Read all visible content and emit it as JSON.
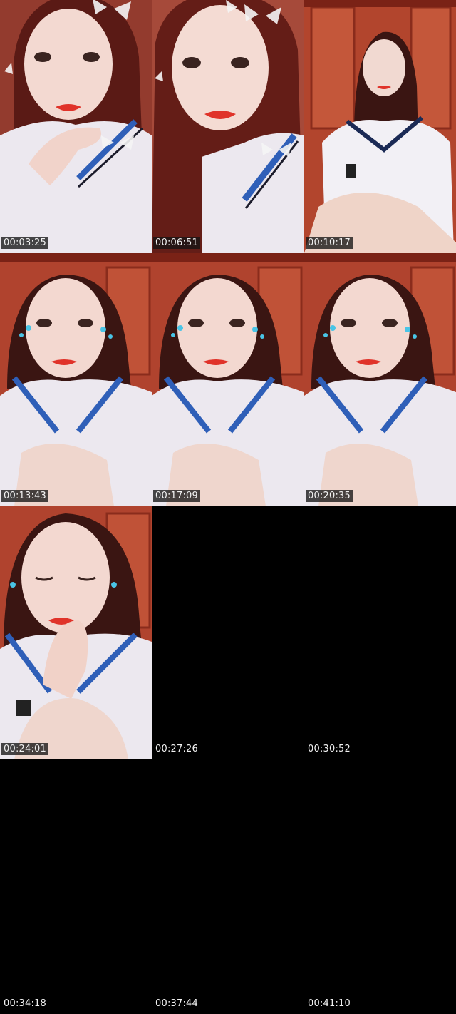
{
  "frames": [
    {
      "timestamp": "00:03:25",
      "has_image": true,
      "scene": "butterflies"
    },
    {
      "timestamp": "00:06:51",
      "has_image": true,
      "scene": "butterflies"
    },
    {
      "timestamp": "00:10:17",
      "has_image": true,
      "scene": "wide"
    },
    {
      "timestamp": "00:13:43",
      "has_image": true,
      "scene": "tears"
    },
    {
      "timestamp": "00:17:09",
      "has_image": true,
      "scene": "tears"
    },
    {
      "timestamp": "00:20:35",
      "has_image": true,
      "scene": "tears"
    },
    {
      "timestamp": "00:24:01",
      "has_image": true,
      "scene": "eyes-closed"
    },
    {
      "timestamp": "00:27:26",
      "has_image": false
    },
    {
      "timestamp": "00:30:52",
      "has_image": false
    },
    {
      "timestamp": "00:34:18",
      "has_image": false
    },
    {
      "timestamp": "00:37:44",
      "has_image": false
    },
    {
      "timestamp": "00:41:10",
      "has_image": false
    }
  ],
  "colors": {
    "background": "#000000",
    "wardrobe": "#b0432e",
    "hair": "#3a1512",
    "skin": "#f3d6cf",
    "shirt": "#eceaf2",
    "collar_stripe": "#2f5fb8",
    "lips": "#e23a2a"
  }
}
